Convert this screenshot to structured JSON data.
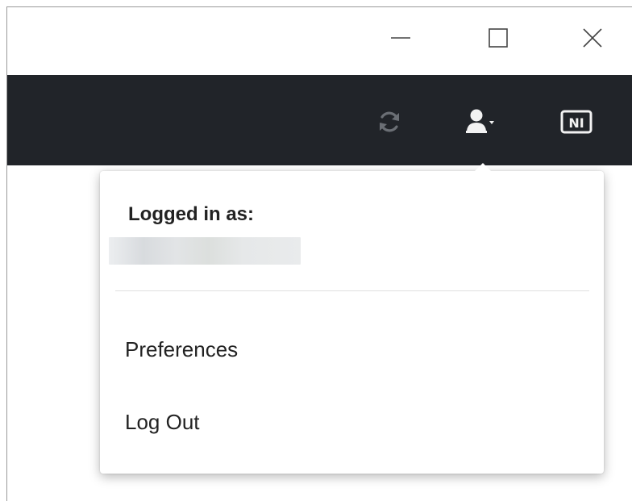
{
  "window_controls": {
    "minimize_icon": "minimize-icon",
    "maximize_icon": "maximize-icon",
    "close_icon": "close-icon"
  },
  "toolbar": {
    "background": "#212429",
    "icons": [
      "sync-icon",
      "user-icon",
      "ni-logo-icon"
    ],
    "logo_text": "NI"
  },
  "dropdown": {
    "heading": "Logged in as:",
    "username": "",
    "items": [
      {
        "label": "Preferences"
      },
      {
        "label": "Log Out"
      }
    ]
  }
}
